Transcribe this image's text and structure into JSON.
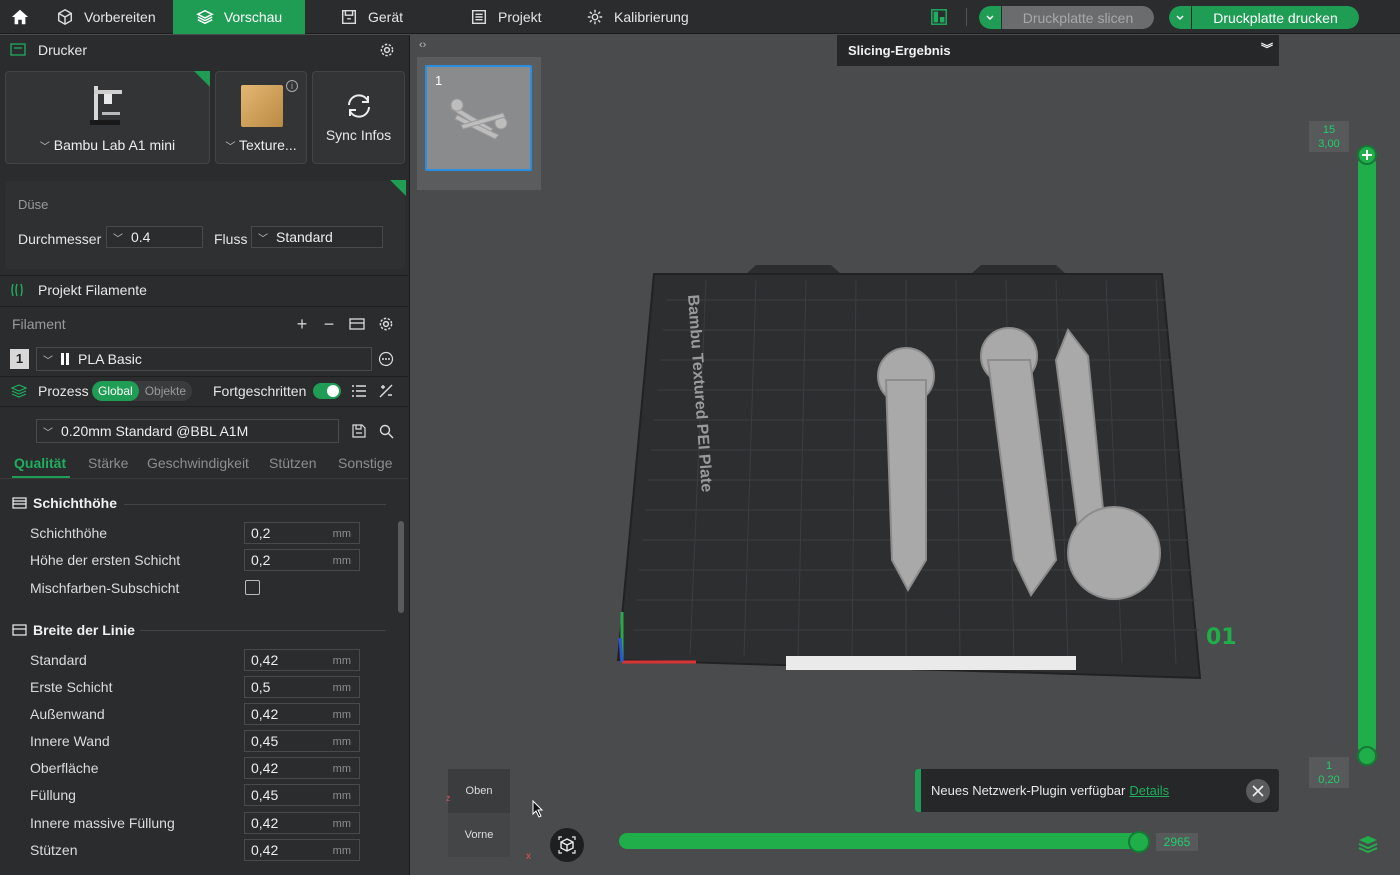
{
  "topbar": {
    "tabs": [
      {
        "label": "Vorbereiten"
      },
      {
        "label": "Vorschau"
      },
      {
        "label": "Gerät"
      },
      {
        "label": "Projekt"
      },
      {
        "label": "Kalibrierung"
      }
    ],
    "slice_button": "Druckplatte slicen",
    "print_button": "Druckplatte drucken"
  },
  "printer": {
    "section_title": "Drucker",
    "printer_name": "Bambu Lab A1 mini",
    "plate_name": "Texture...",
    "sync_label": "Sync Infos"
  },
  "nozzle": {
    "title": "Düse",
    "diameter_label": "Durchmesser",
    "diameter_value": "0.4",
    "flow_label": "Fluss",
    "flow_value": "Standard"
  },
  "filaments": {
    "section_title": "Projekt Filamente",
    "list_label": "Filament",
    "items": [
      {
        "index": "1",
        "name": "PLA Basic"
      }
    ]
  },
  "process": {
    "title": "Prozess",
    "global_label": "Global",
    "objects_label": "Objekte",
    "advanced_label": "Fortgeschritten",
    "advanced_on": true,
    "profile": "0.20mm Standard @BBL A1M"
  },
  "settings_tabs": [
    "Qualität",
    "Stärke",
    "Geschwindigkeit",
    "Stützen",
    "Sonstige"
  ],
  "quality": {
    "layer_group": "Schichthöhe",
    "layer_rows": [
      {
        "label": "Schichthöhe",
        "value": "0,2",
        "unit": "mm"
      },
      {
        "label": "Höhe der ersten Schicht",
        "value": "0,2",
        "unit": "mm"
      }
    ],
    "mix_label": "Mischfarben-Subschicht",
    "width_group": "Breite der Linie",
    "width_rows": [
      {
        "label": "Standard",
        "value": "0,42",
        "unit": "mm"
      },
      {
        "label": "Erste Schicht",
        "value": "0,5",
        "unit": "mm"
      },
      {
        "label": "Außenwand",
        "value": "0,42",
        "unit": "mm"
      },
      {
        "label": "Innere Wand",
        "value": "0,45",
        "unit": "mm"
      },
      {
        "label": "Oberfläche",
        "value": "0,42",
        "unit": "mm"
      },
      {
        "label": "Füllung",
        "value": "0,45",
        "unit": "mm"
      },
      {
        "label": "Innere massive Füllung",
        "value": "0,42",
        "unit": "mm"
      },
      {
        "label": "Stützen",
        "value": "0,42",
        "unit": "mm"
      }
    ]
  },
  "viewport": {
    "plate_thumb_number": "1",
    "slicing_result_title": "Slicing-Ergebnis",
    "plate_print_text": "Bambu Textured PEI Plate",
    "plate_number_mark": "01",
    "layer_top": {
      "layer": "15",
      "height": "3,00"
    },
    "layer_bottom": {
      "layer": "1",
      "height": "0,20"
    },
    "move_count": "2965",
    "notification": {
      "text": "Neues Netzwerk-Plugin verfügbar",
      "link": "Details"
    },
    "view_cube": {
      "top": "Oben",
      "front": "Vorne"
    },
    "axis_z": "z",
    "axis_x": "x"
  },
  "colors": {
    "accent": "#1f9d55",
    "panel": "#2b2c2e",
    "viewport": "#4a4b4d"
  }
}
